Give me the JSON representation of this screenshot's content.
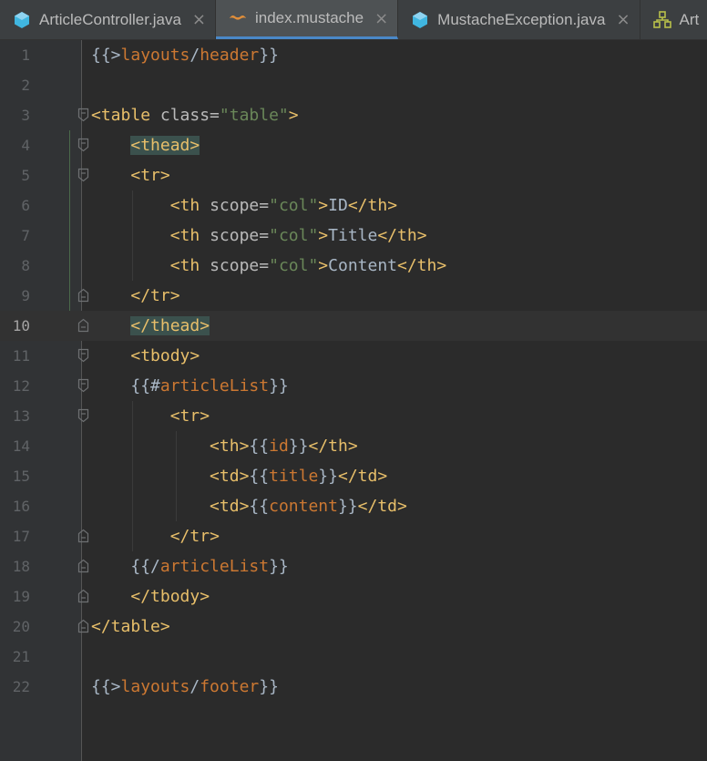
{
  "tabs": [
    {
      "label": "ArticleController.java",
      "icon": "java-class-icon",
      "active": false,
      "closable": true
    },
    {
      "label": "index.mustache",
      "icon": "mustache-file-icon",
      "active": true,
      "closable": true
    },
    {
      "label": "MustacheException.java",
      "icon": "java-class-icon",
      "active": false,
      "closable": true
    },
    {
      "label": "Art",
      "icon": "project-structure-icon",
      "active": false,
      "closable": false
    }
  ],
  "close_glyph": "×",
  "current_line": 10,
  "line_numbers": [
    "1",
    "2",
    "3",
    "4",
    "5",
    "6",
    "7",
    "8",
    "9",
    "10",
    "11",
    "12",
    "13",
    "14",
    "15",
    "16",
    "17",
    "18",
    "19",
    "20",
    "21",
    "22"
  ],
  "code_lines": [
    "{{>layouts/header}}",
    "",
    "<table class=\"table\">",
    "    <thead>",
    "    <tr>",
    "        <th scope=\"col\">ID</th>",
    "        <th scope=\"col\">Title</th>",
    "        <th scope=\"col\">Content</th>",
    "    </tr>",
    "    </thead>",
    "    <tbody>",
    "    {{#articleList}}",
    "        <tr>",
    "            <th>{{id}}</th>",
    "            <td>{{title}}</td>",
    "            <td>{{content}}</td>",
    "        </tr>",
    "    {{/articleList}}",
    "    </tbody>",
    "</table>",
    "",
    "{{>layouts/footer}}"
  ],
  "colors": {
    "background": "#2b2b2b",
    "gutter": "#313335",
    "tag": "#e8bf6a",
    "attribute": "#bababa",
    "string": "#6a8759",
    "mustache_variable": "#cc7832",
    "text": "#a9b7c6",
    "line_number": "#606366",
    "tab_accent": "#4a88c7",
    "tag_match_highlight": "#3b514d"
  }
}
